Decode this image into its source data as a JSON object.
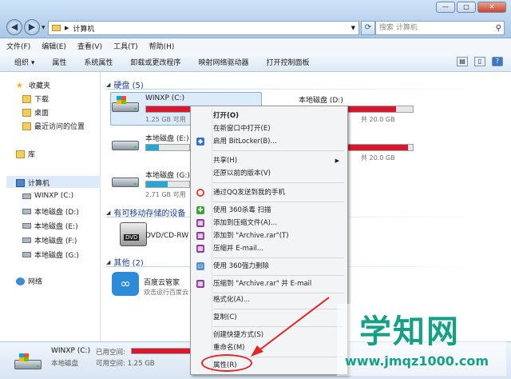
{
  "window": {
    "minimize": "—",
    "maximize": "□",
    "close": "✕"
  },
  "address": {
    "crumb": "计算机"
  },
  "search": {
    "placeholder": "搜索 计算机"
  },
  "menu": [
    "文件(F)",
    "编辑(E)",
    "查看(V)",
    "工具(T)",
    "帮助(H)"
  ],
  "toolbar": [
    "组织 ▾",
    "属性",
    "系统属性",
    "卸载或更改程序",
    "映射网络驱动器",
    "打开控制面板"
  ],
  "nav": {
    "favorites": "收藏夹",
    "downloads": "下载",
    "desktop": "桌面",
    "recent": "最近访问的位置",
    "library": "库",
    "computer": "计算机",
    "drives": [
      "WINXP (C:)",
      "本地磁盘 (D:)",
      "本地磁盘 (E:)",
      "本地磁盘 (F:)",
      "本地磁盘 (G:)"
    ],
    "network": "网络"
  },
  "groups": {
    "hdd": "硬盘 (5)",
    "removable": "有可移动存储的设备",
    "other": "其他 (2)"
  },
  "drives": [
    {
      "name": "WINXP (C:)",
      "sub": "1.25 GB 可用",
      "used": 0.94,
      "color": "#d9182e"
    },
    {
      "name": "本地磁盘 (D:)",
      "sub": "共 20.0 GB",
      "used": 0.85,
      "color": "#d9182e"
    },
    {
      "name": "本地磁盘 (E:)",
      "sub": "",
      "used": 0.3,
      "color": "#27a6d6"
    },
    {
      "name": "本地磁盘 (F:)",
      "sub": "共 20.0 GB",
      "used": 0.96,
      "color": "#d9182e"
    },
    {
      "name": "本地磁盘 (G:)",
      "sub": "2.71 GB 可用",
      "used": 0.5,
      "color": "#27a6d6"
    }
  ],
  "removable_item": {
    "name": "DVD/CD-RW",
    "icon_label": "DVD"
  },
  "other_item": {
    "name": "百度云管家",
    "sub": "双击运行百度云",
    "icon": "∞"
  },
  "context_menu": [
    "打开(O)",
    "在新窗口中打开(E)",
    "启用 BitLocker(B)...",
    "共享(H)",
    "还原以前的版本(V)",
    "通过QQ发送到我的手机",
    "使用 360杀毒 扫描",
    "添加到压缩文件(A)...",
    "添加到 \"Archive.rar\"(T)",
    "压缩并 E-mail...",
    "使用 360强力删除",
    "压缩到 \"Archive.rar\" 并 E-mail",
    "格式化(A)...",
    "复制(C)",
    "创建快捷方式(S)",
    "重命名(M)",
    "属性(R)"
  ],
  "status": {
    "name": "WINXP (C:)",
    "used_label": "已用空间:",
    "type": "本地磁盘",
    "free_label": "可用空间: 1.25 GB",
    "used": 0.94
  },
  "watermark": {
    "text": "学知网",
    "url": "www.jmqz1000.com"
  }
}
